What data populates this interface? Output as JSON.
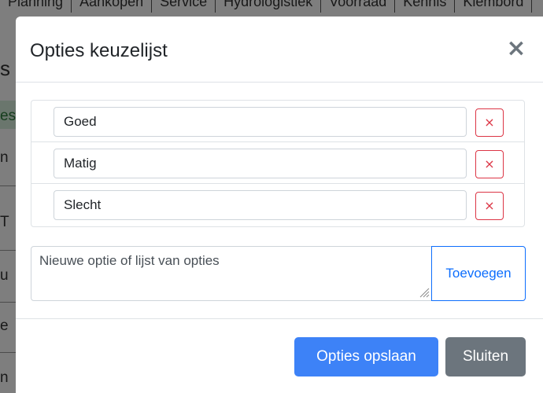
{
  "background": {
    "nav_tabs": [
      "Planning",
      "Aankopen",
      "Service",
      "Hydrologistiek",
      "Voorraad",
      "Kennis",
      "Klembord"
    ],
    "left_fragments": [
      "s",
      "es",
      "n",
      "T",
      "u",
      "e",
      "n"
    ]
  },
  "modal": {
    "title": "Opties keuzelijst",
    "close_symbol": "×",
    "options": [
      {
        "value": "Goed",
        "remove_symbol": "×"
      },
      {
        "value": "Matig",
        "remove_symbol": "×"
      },
      {
        "value": "Slecht",
        "remove_symbol": "×"
      }
    ],
    "new_option": {
      "placeholder": "Nieuwe optie of lijst van opties",
      "value": ""
    },
    "add_label": "Toevoegen",
    "save_label": "Opties opslaan",
    "close_label": "Sluiten"
  },
  "colors": {
    "primary": "#3d82f7",
    "danger": "#dc3545",
    "secondary": "#6c757d",
    "success_bg": "#d4edda"
  }
}
